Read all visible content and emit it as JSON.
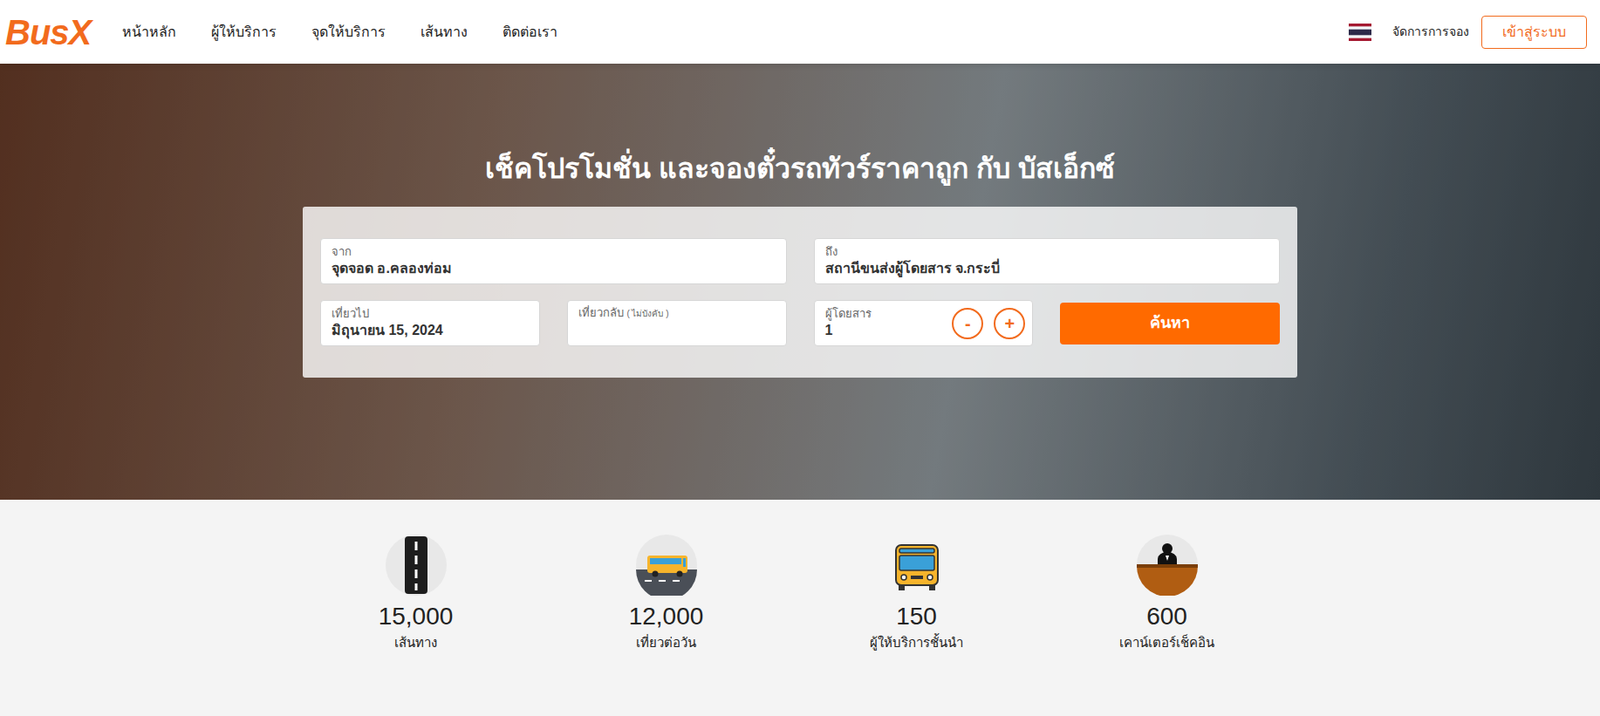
{
  "header": {
    "logo": "BusX",
    "nav": [
      "หน้าหลัก",
      "ผู้ให้บริการ",
      "จุดให้บริการ",
      "เส้นทาง",
      "ติดต่อเรา"
    ],
    "manage_booking": "จัดการการจอง",
    "login": "เข้าสู่ระบบ"
  },
  "hero": {
    "title": "เช็คโปรโมชั่น และจองตั๋วรถทัวร์ราคาถูก กับ บัสเอ็กซ์",
    "search": {
      "from": {
        "label": "จาก",
        "value": "จุดจอด อ.คลองท่อม"
      },
      "to": {
        "label": "ถึง",
        "value": "สถานีขนส่งผู้โดยสาร จ.กระบี่"
      },
      "depart": {
        "label": "เที่ยวไป",
        "value": "มิถุนายน 15, 2024"
      },
      "return": {
        "label": "เที่ยวกลับ",
        "hint": "( ไม่บังคับ )"
      },
      "passengers": {
        "label": "ผู้โดยสาร",
        "value": "1",
        "minus": "-",
        "plus": "+"
      },
      "button": "ค้นหา"
    }
  },
  "stats": [
    {
      "value": "15,000",
      "label": "เส้นทาง",
      "kind": "road"
    },
    {
      "value": "12,000",
      "label": "เที่ยวต่อวัน",
      "kind": "bus"
    },
    {
      "value": "150",
      "label": "ผู้ให้บริการชั้นนำ",
      "kind": "coach"
    },
    {
      "value": "600",
      "label": "เคาน์เตอร์เช็คอิน",
      "kind": "counter"
    }
  ]
}
